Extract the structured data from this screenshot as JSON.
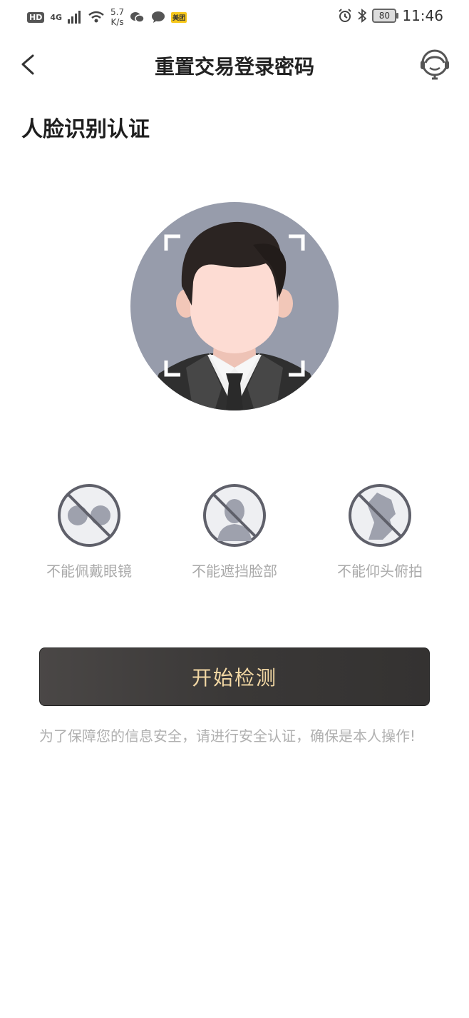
{
  "status_bar": {
    "hd": "HD",
    "network": "4G",
    "speed_value": "5.7",
    "speed_unit": "K/s",
    "app_badge": "美团",
    "battery": "80",
    "time": "11:46"
  },
  "nav": {
    "title": "重置交易登录密码"
  },
  "section_title": "人脸识别认证",
  "tips": [
    {
      "label": "不能佩戴眼镜",
      "icon": "no-glasses-icon"
    },
    {
      "label": "不能遮挡脸部",
      "icon": "no-face-cover-icon"
    },
    {
      "label": "不能仰头俯拍",
      "icon": "no-tilt-head-icon"
    }
  ],
  "start_button": "开始检测",
  "notice": "为了保障您的信息安全，请进行安全认证，确保是本人操作!",
  "colors": {
    "button_bg": "#3a3837",
    "button_text": "#f3d8a4",
    "avatar_bg": "#979cab",
    "tip_gray": "#aaaaaa"
  }
}
